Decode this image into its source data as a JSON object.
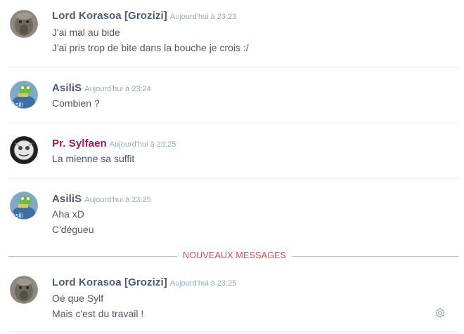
{
  "messages": [
    {
      "username": "Lord Korasoa [Grozizi]",
      "timestamp": "Aujourd'hui à 23:23",
      "lines": [
        "J'ai mal au bide",
        "J'ai pris trop de bite dans la bouche je crois :/"
      ]
    },
    {
      "username": "AsiliS",
      "timestamp": "Aujourd'hui à 23:24",
      "lines": [
        "Combien ?"
      ]
    },
    {
      "username": "Pr. Sylfaen",
      "timestamp": "Aujourd'hui à 23:25",
      "lines": [
        "La mienne sa suffit"
      ]
    },
    {
      "username": "AsiliS",
      "timestamp": "Aujourd'hui à 23:25",
      "lines": [
        "Aha xD",
        "C'dégueu"
      ]
    },
    {
      "username": "Lord Korasoa [Grozizi]",
      "timestamp": "Aujourd'hui à 23:25",
      "lines": [
        "Oé que Sylf",
        "Mais c'est du travail !"
      ]
    }
  ],
  "new_messages_label": "NOUVEAUX MESSAGES",
  "avatar_text": "Asili",
  "icons": {
    "settings": "gear-icon"
  },
  "colors": {
    "username": "#4f5d6a",
    "username_special": "#a8164f",
    "new_messages": "#e9434a",
    "timestamp": "#99aab5"
  }
}
